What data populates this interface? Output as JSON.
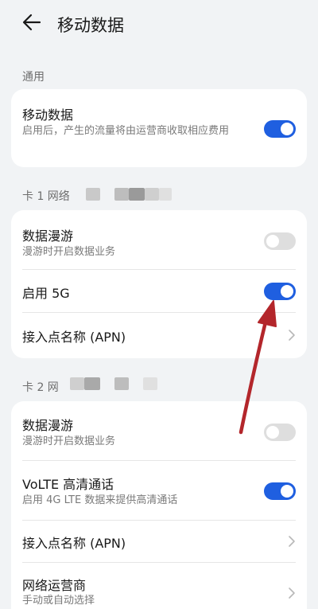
{
  "header": {
    "title": "移动数据"
  },
  "general": {
    "label": "通用",
    "mobile_data": {
      "title": "移动数据",
      "subtitle": "启用后，产生的流量将由运营商收取相应费用",
      "enabled": true
    }
  },
  "sim1": {
    "label": "卡 1 网络",
    "roaming": {
      "title": "数据漫游",
      "subtitle": "漫游时开启数据业务",
      "enabled": false
    },
    "enable_5g": {
      "title": "启用 5G",
      "enabled": true
    },
    "apn": {
      "title": "接入点名称 (APN)"
    }
  },
  "sim2": {
    "label": "卡 2 网",
    "roaming": {
      "title": "数据漫游",
      "subtitle": "漫游时开启数据业务",
      "enabled": false
    },
    "volte": {
      "title": "VoLTE 高清通话",
      "subtitle": "启用 4G LTE 数据来提供高清通话",
      "enabled": true
    },
    "apn": {
      "title": "接入点名称 (APN)"
    },
    "carrier": {
      "title": "网络运营商",
      "subtitle": "手动或自动选择"
    }
  },
  "colors": {
    "accent": "#1f5fe0",
    "annotation": "#b3262b"
  }
}
